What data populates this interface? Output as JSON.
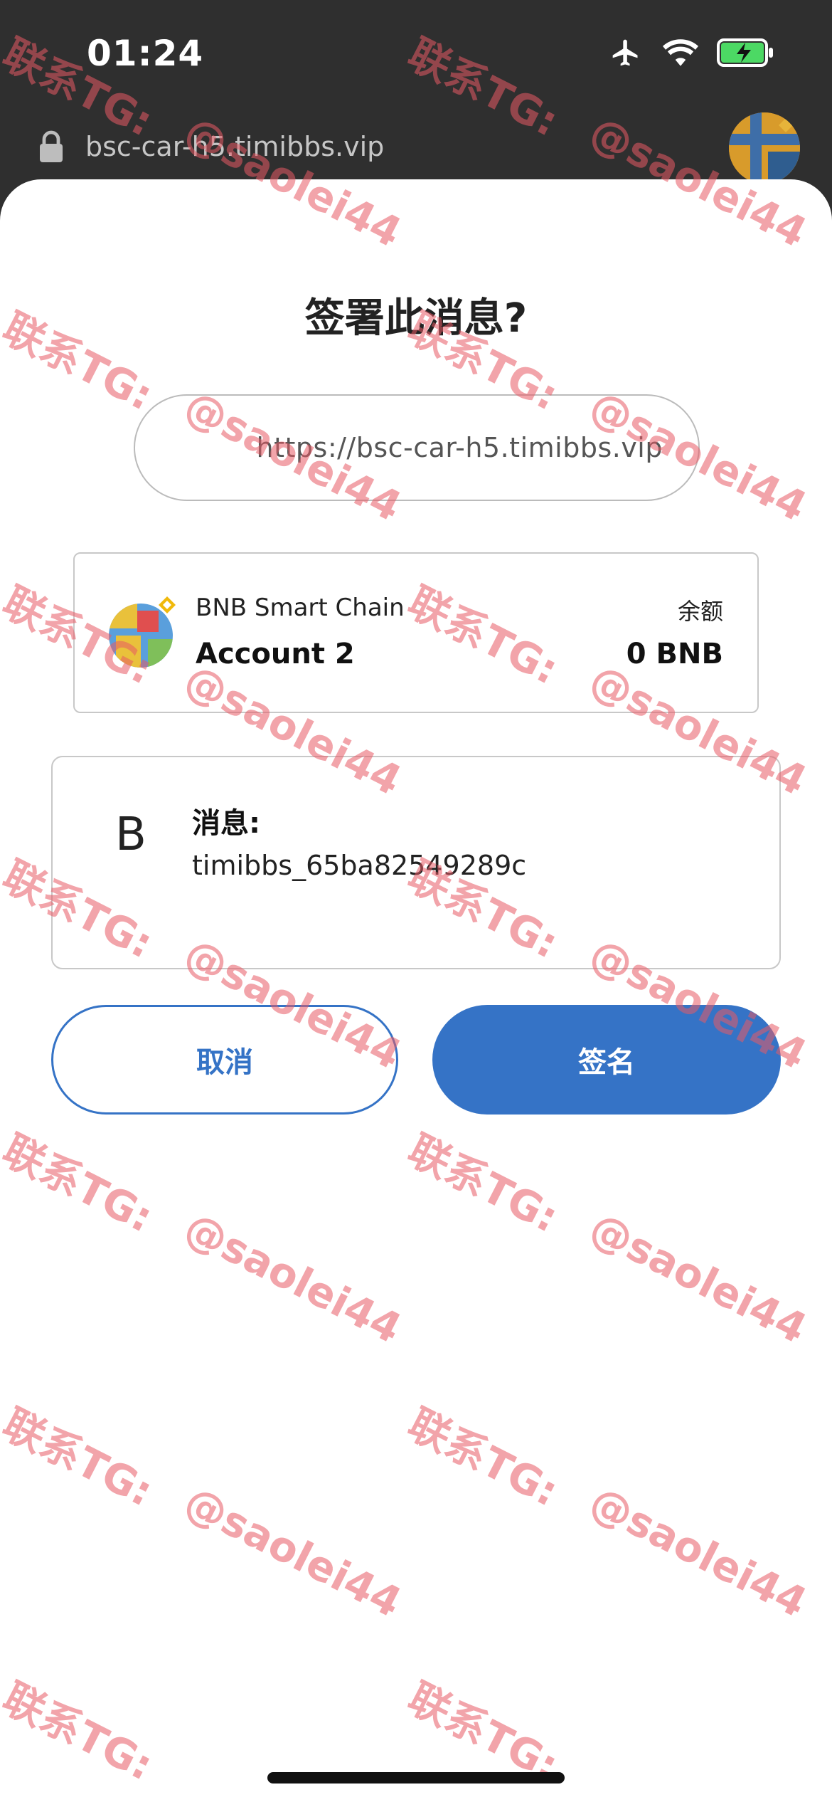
{
  "status_bar": {
    "time": "01:24"
  },
  "browser": {
    "url": "bsc-car-h5.timibbs.vip"
  },
  "sheet": {
    "title": "签署此消息?",
    "origin_url": "https://bsc-car-h5.timibbs.vip"
  },
  "account": {
    "network": "BNB Smart Chain",
    "name": "Account 2",
    "balance_label": "余额",
    "balance_value": "0 BNB"
  },
  "message": {
    "initial": "B",
    "label": "消息:",
    "text": "timibbs_65ba82549289c"
  },
  "actions": {
    "cancel_label": "取消",
    "sign_label": "签名"
  },
  "watermark": {
    "line1": "联系TG:",
    "line2": "@saolei44"
  },
  "colors": {
    "accent": "#3573c6",
    "watermark": "#e85a64"
  }
}
